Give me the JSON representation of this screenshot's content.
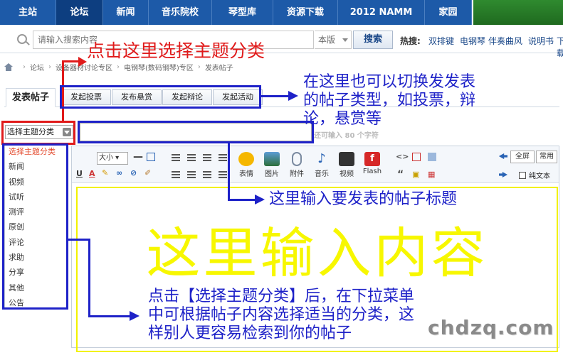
{
  "nav": {
    "items": [
      {
        "label": "主站",
        "active": false
      },
      {
        "label": "论坛",
        "active": true
      },
      {
        "label": "新闻",
        "active": false
      },
      {
        "label": "音乐院校",
        "active": false
      },
      {
        "label": "琴型库",
        "active": false
      },
      {
        "label": "资源下载",
        "active": false
      },
      {
        "label": "2012 NAMM",
        "active": false
      },
      {
        "label": "家园",
        "active": false
      }
    ]
  },
  "search": {
    "placeholder": "请输入搜索内容",
    "scope": "本版",
    "button": "搜索",
    "hot_label": "热搜:",
    "hot_links": [
      "双排键",
      "电钢琴",
      "伴奏曲风",
      "说明书",
      "下载"
    ]
  },
  "breadcrumb": {
    "items": [
      "论坛",
      "设备器材讨论专区",
      "电钢琴(数码钢琴)专区",
      "发表帖子"
    ]
  },
  "post": {
    "main_tab": "发表帖子",
    "action_tabs": [
      "发起投票",
      "发布悬赏",
      "发起辩论",
      "发起活动"
    ],
    "category_select": "选择主题分类",
    "char_hint": "还可输入 80 个字符",
    "category_options": [
      "选择主题分类",
      "新闻",
      "视频",
      "试听",
      "测评",
      "原创",
      "评论",
      "求助",
      "分享",
      "其他",
      "公告"
    ]
  },
  "editor": {
    "font_size": "大小",
    "tools": [
      "表情",
      "图片",
      "附件",
      "音乐",
      "视频",
      "Flash"
    ],
    "fullscreen": "全屏",
    "common": "常用",
    "plain_text": "纯文本",
    "content_placeholder": "这里输入内容"
  },
  "annotations": {
    "select_category": "点击这里选择主题分类",
    "switch_type_line1": "在这里也可以切换发发表",
    "switch_type_line2": "的帖子类型，如投票，辩",
    "switch_type_line3": "论，悬赏等",
    "title_hint": "这里输入要发表的帖子标题",
    "dropdown_hint_line1": "点击【选择主题分类】后，在下拉菜单",
    "dropdown_hint_line2": "中可根据帖子内容选择适当的分类，这",
    "dropdown_hint_line3": "样别人更容易检索到你的帖子"
  },
  "watermark": "chdzq.com",
  "colors": {
    "nav_bg": "#1d5aa8",
    "nav_active": "#0d3e80",
    "annotation_blue": "#1e22c8",
    "annotation_red": "#e01a1a",
    "content_yellow": "#f7f700",
    "selected_option": "#e34a2d"
  }
}
